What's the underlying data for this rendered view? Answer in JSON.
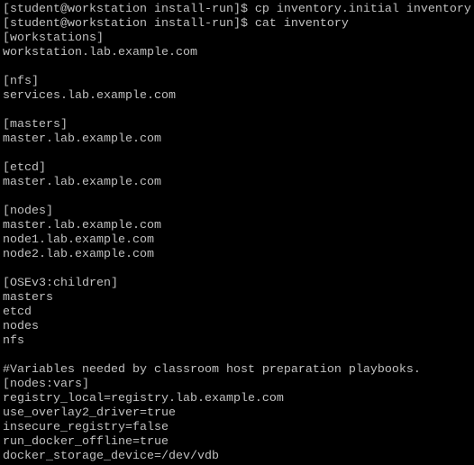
{
  "terminal": {
    "lines": [
      "[student@workstation install-run]$ cp inventory.initial inventory",
      "[student@workstation install-run]$ cat inventory",
      "[workstations]",
      "workstation.lab.example.com",
      "",
      "[nfs]",
      "services.lab.example.com",
      "",
      "[masters]",
      "master.lab.example.com",
      "",
      "[etcd]",
      "master.lab.example.com",
      "",
      "[nodes]",
      "master.lab.example.com",
      "node1.lab.example.com",
      "node2.lab.example.com",
      "",
      "[OSEv3:children]",
      "masters",
      "etcd",
      "nodes",
      "nfs",
      "",
      "#Variables needed by classroom host preparation playbooks.",
      "[nodes:vars]",
      "registry_local=registry.lab.example.com",
      "use_overlay2_driver=true",
      "insecure_registry=false",
      "run_docker_offline=true",
      "docker_storage_device=/dev/vdb"
    ]
  }
}
